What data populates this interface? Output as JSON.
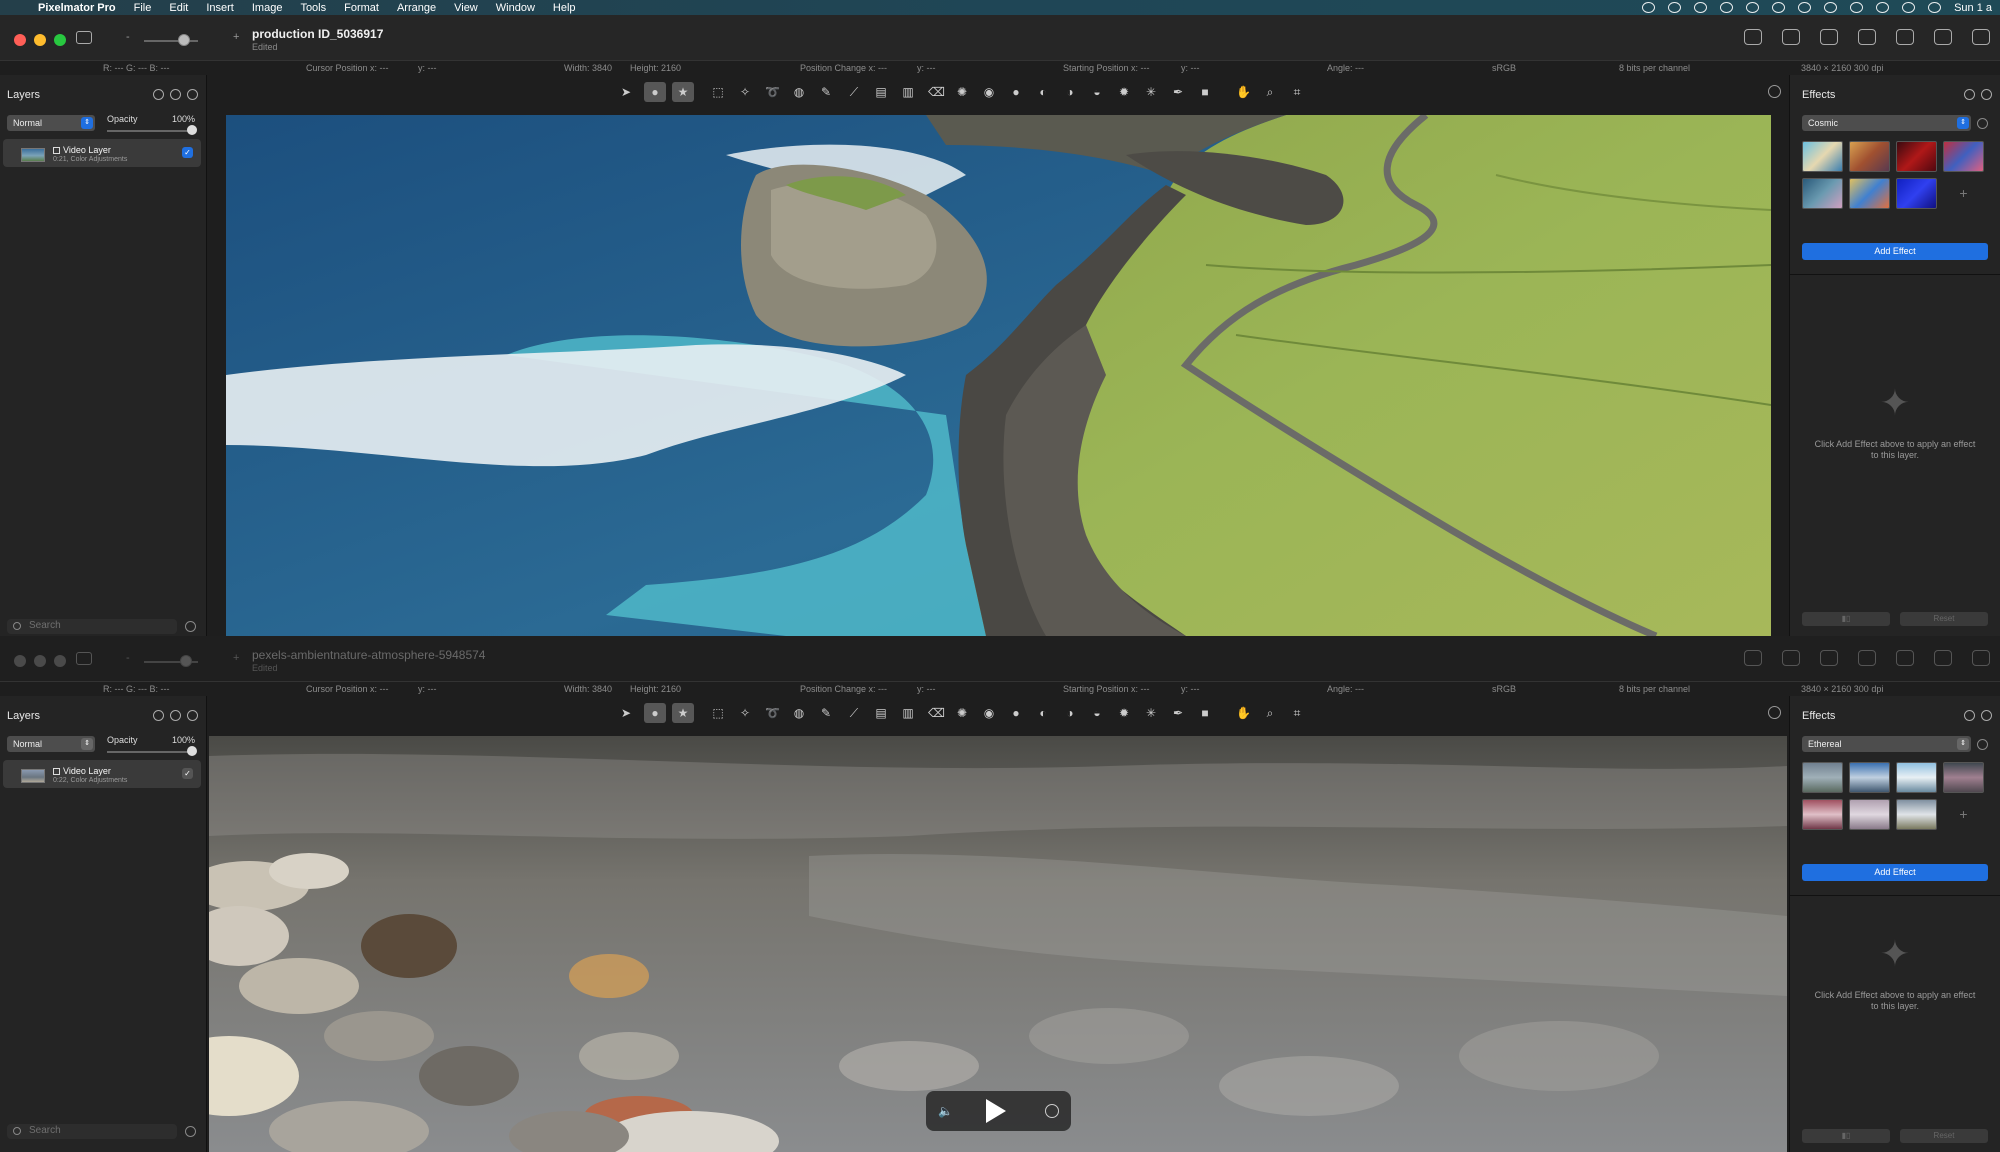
{
  "menubar": {
    "app_name": "Pixelmator Pro",
    "items": [
      "File",
      "Edit",
      "Insert",
      "Image",
      "Tools",
      "Format",
      "Arrange",
      "View",
      "Window",
      "Help"
    ],
    "clock": "Sun 1 a"
  },
  "window1": {
    "title": "production ID_5036917",
    "subtitle": "Edited",
    "info": {
      "rgb": "R: ---   G: ---   B: ---",
      "cursor": "Cursor Position x: ---",
      "cursor_y": "y: ---",
      "width": "Width: 3840",
      "height": "Height: 2160",
      "position_change": "Position Change x: ---",
      "position_change_y": "y: ---",
      "starting": "Starting Position x: ---",
      "starting_y": "y: ---",
      "angle": "Angle: ---",
      "colorspace": "sRGB",
      "bits": "8 bits per channel",
      "dims": "3840 × 2160 300 dpi"
    },
    "layers": {
      "title": "Layers",
      "blend_mode": "Normal",
      "opacity_label": "Opacity",
      "opacity_value": "100%",
      "opacity_fraction": 1.0,
      "layer_name": "Video Layer",
      "layer_sub": "0:21, Color Adjustments",
      "search_placeholder": "Search"
    },
    "effects": {
      "title": "Effects",
      "category": "Cosmic",
      "add_button": "Add Effect",
      "empty_text": "Click Add Effect above to apply an effect to this layer.",
      "reset": "Reset"
    }
  },
  "window2": {
    "title": "pexels-ambientnature-atmosphere-5948574",
    "subtitle": "Edited",
    "info": {
      "rgb": "R: ---   G: ---   B: ---",
      "cursor": "Cursor Position x: ---",
      "cursor_y": "y: ---",
      "width": "Width: 3840",
      "height": "Height: 2160",
      "position_change": "Position Change x: ---",
      "position_change_y": "y: ---",
      "starting": "Starting Position x: ---",
      "starting_y": "y: ---",
      "angle": "Angle: ---",
      "colorspace": "sRGB",
      "bits": "8 bits per channel",
      "dims": "3840 × 2160 300 dpi"
    },
    "layers": {
      "title": "Layers",
      "blend_mode": "Normal",
      "opacity_label": "Opacity",
      "opacity_value": "100%",
      "opacity_fraction": 1.0,
      "layer_name": "Video Layer",
      "layer_sub": "0:22, Color Adjustments",
      "search_placeholder": "Search"
    },
    "effects": {
      "title": "Effects",
      "category": "Ethereal",
      "add_button": "Add Effect",
      "empty_text": "Click Add Effect above to apply an effect to this layer.",
      "reset": "Reset"
    }
  },
  "colors": {
    "accent": "#1f6fe0",
    "close": "#ff5f57",
    "minimize": "#febc2e",
    "zoom": "#28c840"
  }
}
